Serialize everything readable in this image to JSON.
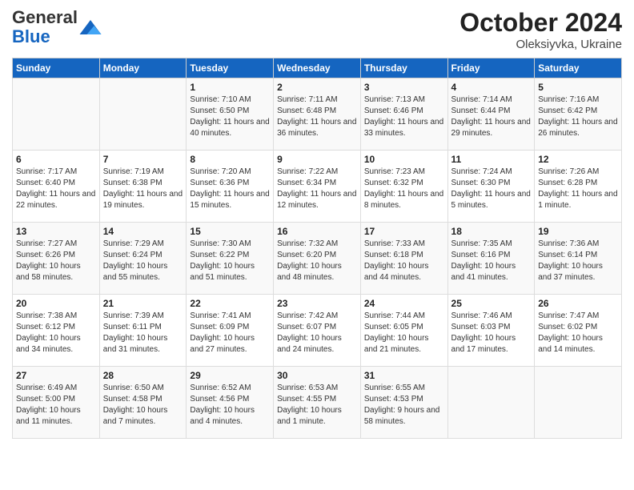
{
  "header": {
    "logo_general": "General",
    "logo_blue": "Blue",
    "month_title": "October 2024",
    "location": "Oleksiyvka, Ukraine"
  },
  "days_of_week": [
    "Sunday",
    "Monday",
    "Tuesday",
    "Wednesday",
    "Thursday",
    "Friday",
    "Saturday"
  ],
  "weeks": [
    [
      {
        "day": "",
        "content": ""
      },
      {
        "day": "",
        "content": ""
      },
      {
        "day": "1",
        "content": "Sunrise: 7:10 AM\nSunset: 6:50 PM\nDaylight: 11 hours and 40 minutes."
      },
      {
        "day": "2",
        "content": "Sunrise: 7:11 AM\nSunset: 6:48 PM\nDaylight: 11 hours and 36 minutes."
      },
      {
        "day": "3",
        "content": "Sunrise: 7:13 AM\nSunset: 6:46 PM\nDaylight: 11 hours and 33 minutes."
      },
      {
        "day": "4",
        "content": "Sunrise: 7:14 AM\nSunset: 6:44 PM\nDaylight: 11 hours and 29 minutes."
      },
      {
        "day": "5",
        "content": "Sunrise: 7:16 AM\nSunset: 6:42 PM\nDaylight: 11 hours and 26 minutes."
      }
    ],
    [
      {
        "day": "6",
        "content": "Sunrise: 7:17 AM\nSunset: 6:40 PM\nDaylight: 11 hours and 22 minutes."
      },
      {
        "day": "7",
        "content": "Sunrise: 7:19 AM\nSunset: 6:38 PM\nDaylight: 11 hours and 19 minutes."
      },
      {
        "day": "8",
        "content": "Sunrise: 7:20 AM\nSunset: 6:36 PM\nDaylight: 11 hours and 15 minutes."
      },
      {
        "day": "9",
        "content": "Sunrise: 7:22 AM\nSunset: 6:34 PM\nDaylight: 11 hours and 12 minutes."
      },
      {
        "day": "10",
        "content": "Sunrise: 7:23 AM\nSunset: 6:32 PM\nDaylight: 11 hours and 8 minutes."
      },
      {
        "day": "11",
        "content": "Sunrise: 7:24 AM\nSunset: 6:30 PM\nDaylight: 11 hours and 5 minutes."
      },
      {
        "day": "12",
        "content": "Sunrise: 7:26 AM\nSunset: 6:28 PM\nDaylight: 11 hours and 1 minute."
      }
    ],
    [
      {
        "day": "13",
        "content": "Sunrise: 7:27 AM\nSunset: 6:26 PM\nDaylight: 10 hours and 58 minutes."
      },
      {
        "day": "14",
        "content": "Sunrise: 7:29 AM\nSunset: 6:24 PM\nDaylight: 10 hours and 55 minutes."
      },
      {
        "day": "15",
        "content": "Sunrise: 7:30 AM\nSunset: 6:22 PM\nDaylight: 10 hours and 51 minutes."
      },
      {
        "day": "16",
        "content": "Sunrise: 7:32 AM\nSunset: 6:20 PM\nDaylight: 10 hours and 48 minutes."
      },
      {
        "day": "17",
        "content": "Sunrise: 7:33 AM\nSunset: 6:18 PM\nDaylight: 10 hours and 44 minutes."
      },
      {
        "day": "18",
        "content": "Sunrise: 7:35 AM\nSunset: 6:16 PM\nDaylight: 10 hours and 41 minutes."
      },
      {
        "day": "19",
        "content": "Sunrise: 7:36 AM\nSunset: 6:14 PM\nDaylight: 10 hours and 37 minutes."
      }
    ],
    [
      {
        "day": "20",
        "content": "Sunrise: 7:38 AM\nSunset: 6:12 PM\nDaylight: 10 hours and 34 minutes."
      },
      {
        "day": "21",
        "content": "Sunrise: 7:39 AM\nSunset: 6:11 PM\nDaylight: 10 hours and 31 minutes."
      },
      {
        "day": "22",
        "content": "Sunrise: 7:41 AM\nSunset: 6:09 PM\nDaylight: 10 hours and 27 minutes."
      },
      {
        "day": "23",
        "content": "Sunrise: 7:42 AM\nSunset: 6:07 PM\nDaylight: 10 hours and 24 minutes."
      },
      {
        "day": "24",
        "content": "Sunrise: 7:44 AM\nSunset: 6:05 PM\nDaylight: 10 hours and 21 minutes."
      },
      {
        "day": "25",
        "content": "Sunrise: 7:46 AM\nSunset: 6:03 PM\nDaylight: 10 hours and 17 minutes."
      },
      {
        "day": "26",
        "content": "Sunrise: 7:47 AM\nSunset: 6:02 PM\nDaylight: 10 hours and 14 minutes."
      }
    ],
    [
      {
        "day": "27",
        "content": "Sunrise: 6:49 AM\nSunset: 5:00 PM\nDaylight: 10 hours and 11 minutes."
      },
      {
        "day": "28",
        "content": "Sunrise: 6:50 AM\nSunset: 4:58 PM\nDaylight: 10 hours and 7 minutes."
      },
      {
        "day": "29",
        "content": "Sunrise: 6:52 AM\nSunset: 4:56 PM\nDaylight: 10 hours and 4 minutes."
      },
      {
        "day": "30",
        "content": "Sunrise: 6:53 AM\nSunset: 4:55 PM\nDaylight: 10 hours and 1 minute."
      },
      {
        "day": "31",
        "content": "Sunrise: 6:55 AM\nSunset: 4:53 PM\nDaylight: 9 hours and 58 minutes."
      },
      {
        "day": "",
        "content": ""
      },
      {
        "day": "",
        "content": ""
      }
    ]
  ]
}
